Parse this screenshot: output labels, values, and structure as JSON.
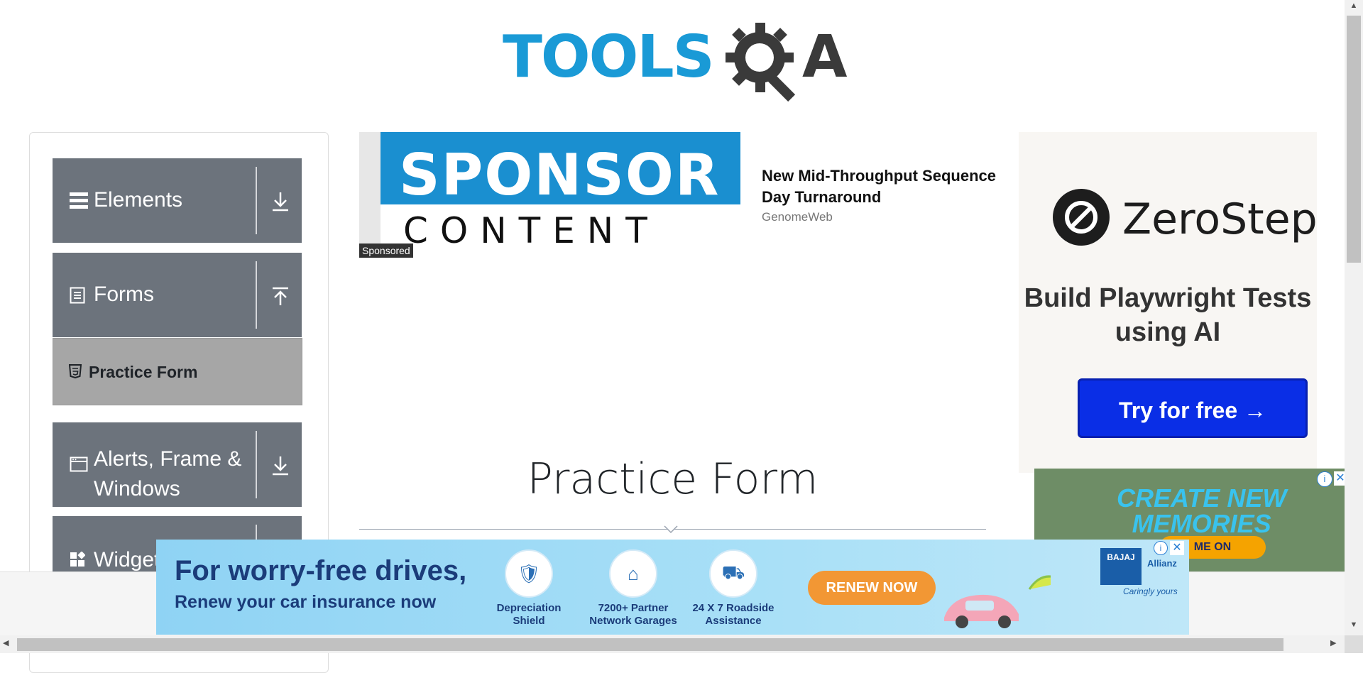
{
  "header": {
    "logo_text_tools": "TOOLS",
    "logo_text_a": "A"
  },
  "sidebar": {
    "groups": [
      {
        "label": "Elements",
        "icon": "hamburger-icon",
        "arrow": "download-arrow-icon"
      },
      {
        "label": "Forms",
        "icon": "document-icon",
        "arrow": "upload-arrow-icon"
      },
      {
        "label": "Alerts, Frame &",
        "label2": "Windows",
        "icon": "window-icon",
        "arrow": "download-arrow-icon"
      },
      {
        "label": "Widgets",
        "icon": "widgets-icon",
        "arrow": "download-arrow-icon"
      }
    ],
    "active_item": {
      "label": "Practice Form",
      "icon": "html5-icon"
    }
  },
  "sponsored_ad": {
    "image_line1": "SPONSOR",
    "image_line2": "CONTENT",
    "tag": "Sponsored",
    "headline": "New Mid-Throughput Sequence Day Turnaround",
    "source": "GenomeWeb"
  },
  "main": {
    "title": "Practice Form"
  },
  "right_ad": {
    "brand": "ZeroStep",
    "tagline": "Build Playwright Tests using AI",
    "cta": "Try for free →"
  },
  "memories_ad": {
    "line1": "CREATE NEW",
    "line2": "MEMORIES",
    "pill": "ME ON",
    "info": "i",
    "close": "✕"
  },
  "bottom_banner": {
    "headline": "For worry-free drives,",
    "subline": "Renew your car insurance now",
    "features": [
      {
        "icon": "car-shield-icon",
        "line1": "Depreciation",
        "line2": "Shield"
      },
      {
        "icon": "garage-map-icon",
        "line1": "7200+ Partner",
        "line2": "Network Garages"
      },
      {
        "icon": "tow-truck-icon",
        "line1": "24 X 7 Roadside",
        "line2": "Assistance"
      }
    ],
    "cta": "RENEW NOW",
    "brand1": "BAJAJ",
    "brand2": "Allianz",
    "slogan": "Caringly yours",
    "info": "i",
    "close": "✕"
  },
  "scrollbars": {
    "up": "▲",
    "down": "▼",
    "left": "◀",
    "right": "▶"
  }
}
